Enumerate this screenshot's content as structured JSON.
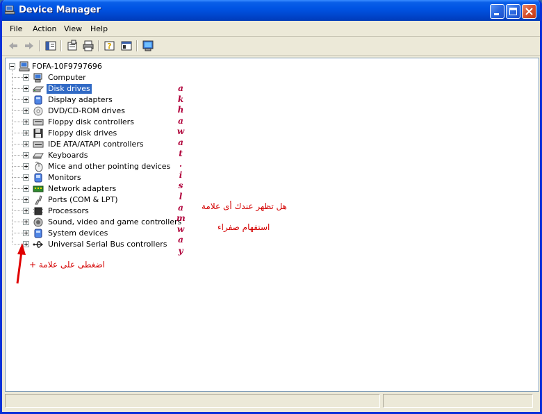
{
  "window": {
    "title": "Device Manager"
  },
  "menu": [
    "File",
    "Action",
    "View",
    "Help"
  ],
  "toolbar": {
    "buttons": [
      "back-arrow-icon",
      "forward-arrow-icon",
      "show-hide-tree-icon",
      "properties-icon",
      "print-icon",
      "help-icon",
      "view-icon",
      "scan-hardware-icon"
    ]
  },
  "tree": {
    "root": "FOFA-10F9797696",
    "items": [
      {
        "label": "Computer",
        "icon": "computer-icon"
      },
      {
        "label": "Disk drives",
        "icon": "disk-drive-icon",
        "selected": true
      },
      {
        "label": "Display adapters",
        "icon": "display-adapter-icon"
      },
      {
        "label": "DVD/CD-ROM drives",
        "icon": "cdrom-icon"
      },
      {
        "label": "Floppy disk controllers",
        "icon": "floppy-controller-icon"
      },
      {
        "label": "Floppy disk drives",
        "icon": "floppy-drive-icon"
      },
      {
        "label": "IDE ATA/ATAPI controllers",
        "icon": "ide-controller-icon"
      },
      {
        "label": "Keyboards",
        "icon": "keyboard-icon"
      },
      {
        "label": "Mice and other pointing devices",
        "icon": "mouse-icon"
      },
      {
        "label": "Monitors",
        "icon": "monitor-icon"
      },
      {
        "label": "Network adapters",
        "icon": "network-adapter-icon"
      },
      {
        "label": "Ports (COM & LPT)",
        "icon": "port-icon"
      },
      {
        "label": "Processors",
        "icon": "processor-icon"
      },
      {
        "label": "Sound, video and game controllers",
        "icon": "sound-icon"
      },
      {
        "label": "System devices",
        "icon": "system-device-icon"
      },
      {
        "label": "Universal Serial Bus controllers",
        "icon": "usb-icon"
      }
    ]
  },
  "watermark": {
    "letters": [
      "a",
      "k",
      "h",
      "a",
      "w",
      "a",
      "t",
      ".",
      "i",
      "s",
      "l",
      "a",
      "m",
      "w",
      "a",
      "y"
    ]
  },
  "annotations": {
    "question_line1": "هل تظهر عندك أى علامة",
    "question_line2": "استفهام صفراء",
    "hint": "اضغطى على علامة +"
  },
  "colors": {
    "title_bar": "#0054e3",
    "selection": "#316ac5",
    "annotation": "#d40000",
    "watermark": "#b0003a"
  }
}
